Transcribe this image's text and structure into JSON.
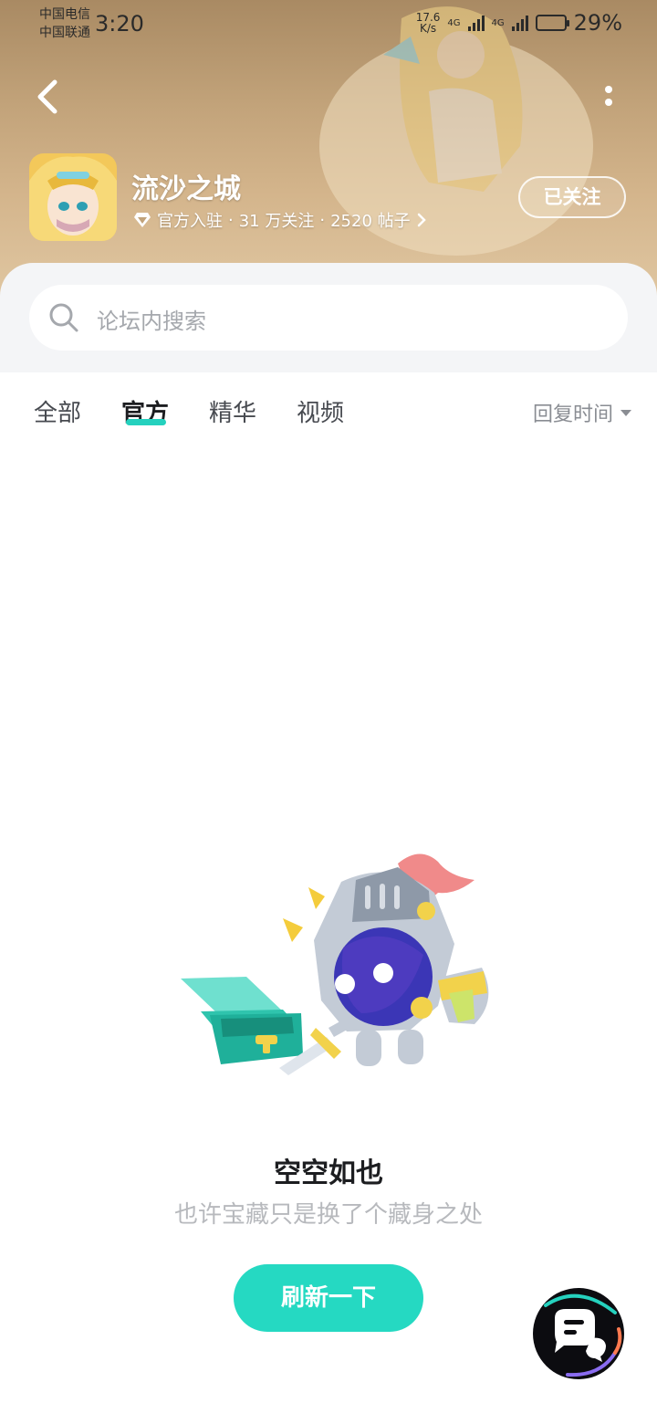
{
  "status_bar": {
    "carrier1": "中国电信",
    "carrier2": "中国联通",
    "time": "3:20",
    "speed_value": "17.6",
    "speed_unit": "K/s",
    "net1": "4G",
    "net2": "4G",
    "battery": "29%"
  },
  "forum": {
    "name": "流沙之城",
    "badge": "官方入驻",
    "followers": "31 万关注",
    "posts": "2520 帖子",
    "follow_label": "已关注"
  },
  "search": {
    "placeholder": "论坛内搜索"
  },
  "tabs": [
    {
      "label": "全部",
      "active": false
    },
    {
      "label": "官方",
      "active": true
    },
    {
      "label": "精华",
      "active": false
    },
    {
      "label": "视频",
      "active": false
    }
  ],
  "sort": {
    "label": "回复时间"
  },
  "empty": {
    "title": "空空如也",
    "subtitle": "也许宝藏只是换了个藏身之处",
    "refresh_label": "刷新一下"
  },
  "colors": {
    "accent": "#25d1be",
    "button": "#25d9c2"
  }
}
